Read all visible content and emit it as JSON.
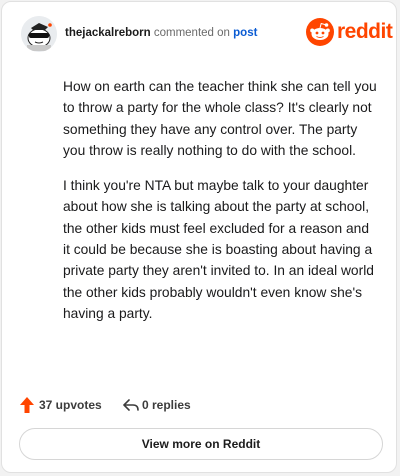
{
  "header": {
    "username": "thejackalreborn",
    "action_text": "commented on",
    "post_link": "post",
    "brand": "reddit"
  },
  "comment": {
    "paragraphs": [
      "How on earth can the teacher think she can tell you to throw a party for the whole class? It's clearly not something they have any control over. The party you throw is really nothing to do with the school.",
      "I think you're NTA but maybe talk to your daughter about how she is talking about the party at school, the other kids must feel excluded for a reason and it could be because she is boasting about having a private party they aren't invited to. In an ideal world the other kids probably wouldn't even know she's having a party."
    ]
  },
  "footer": {
    "upvotes": "37 upvotes",
    "replies": "0 replies",
    "upvote_icon": "upvote-arrow-icon",
    "reply_icon": "reply-arrow-icon"
  },
  "view_more": "View more on Reddit",
  "colors": {
    "brand": "#ff4500",
    "link": "#0a5bd3",
    "text": "#1a1a1b"
  }
}
